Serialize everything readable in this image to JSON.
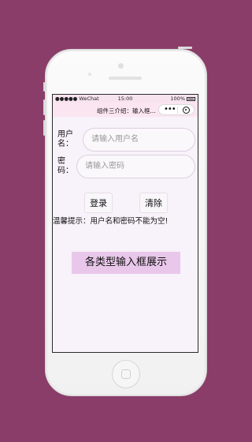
{
  "status_bar": {
    "signal": "●●●●● WeChat",
    "wifi_icon": "wifi-icon",
    "time": "15:00",
    "battery": "100%"
  },
  "navbar": {
    "title": "组件三介绍：输入框...",
    "more": "•••",
    "close_icon": "target-icon"
  },
  "form": {
    "username_label": "用户名：",
    "username_placeholder": "请输入用户名",
    "password_label": "密码：",
    "password_placeholder": "请输入密码",
    "login_label": "登录",
    "clear_label": "清除",
    "hint": "温馨提示：用户名和密码不能为空!"
  },
  "showcase_label": "各类型输入框展示",
  "colors": {
    "background": "#8a3d68",
    "navbar": "#fbe5f1",
    "showcase": "#e9c7ea"
  }
}
